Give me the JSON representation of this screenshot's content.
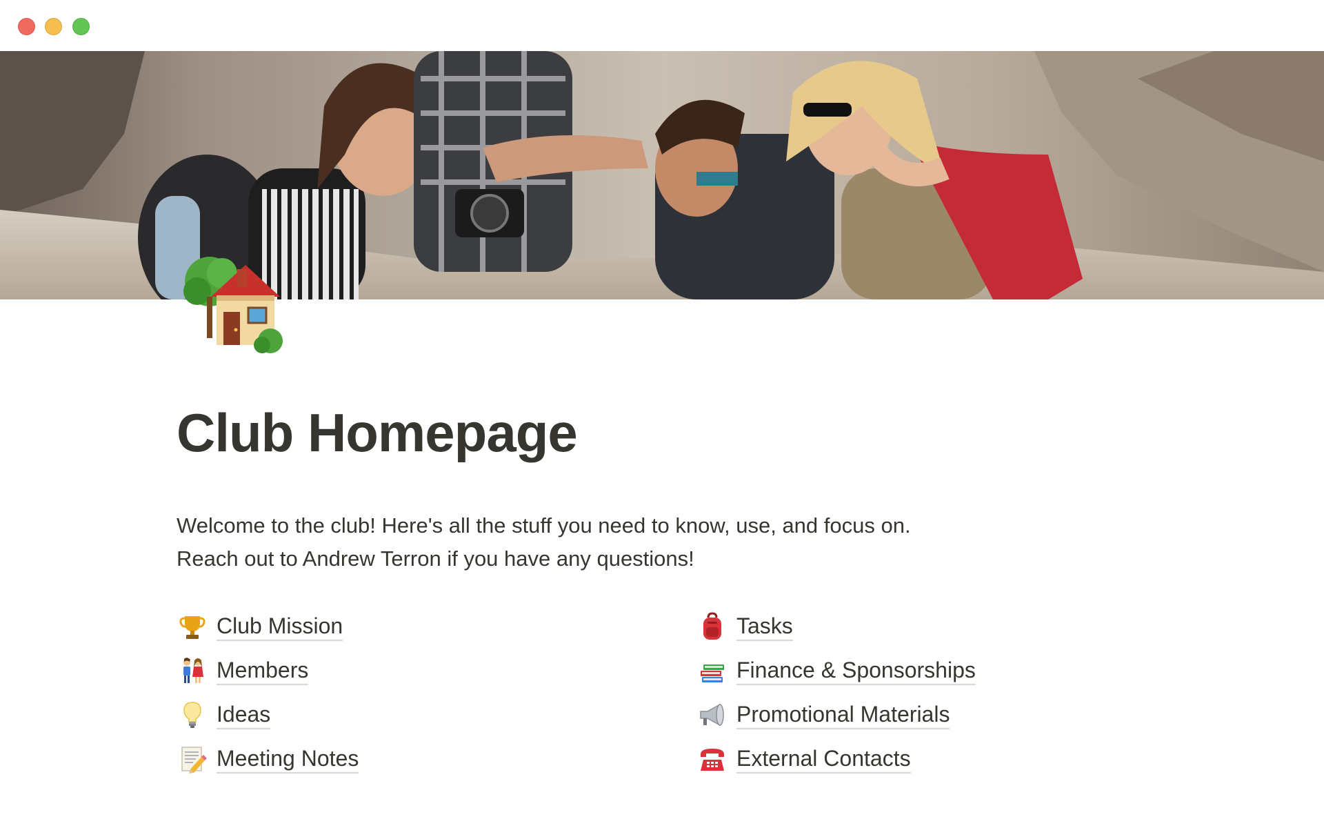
{
  "window": {
    "controls": [
      "close",
      "minimize",
      "maximize"
    ]
  },
  "cover": {
    "description_icon": "cover-photo"
  },
  "page": {
    "icon": "house-with-garden-icon",
    "title": "Club Homepage",
    "intro_lines": [
      "Welcome to the club! Here's all the stuff you need to know, use, and focus on.",
      "Reach out to Andrew Terron if you have any questions!"
    ]
  },
  "links_left": [
    {
      "icon": "trophy-icon",
      "label": "Club Mission"
    },
    {
      "icon": "people-icon",
      "label": "Members"
    },
    {
      "icon": "lightbulb-icon",
      "label": "Ideas"
    },
    {
      "icon": "memo-icon",
      "label": "Meeting Notes"
    }
  ],
  "links_right": [
    {
      "icon": "backpack-icon",
      "label": "Tasks"
    },
    {
      "icon": "books-icon",
      "label": "Finance & Sponsorships"
    },
    {
      "icon": "megaphone-icon",
      "label": "Promotional Materials"
    },
    {
      "icon": "telephone-icon",
      "label": "External Contacts"
    }
  ],
  "colors": {
    "text": "#37352f",
    "underline": "#d9d8d5",
    "close": "#ee6a5f",
    "minimize": "#f5be4f",
    "maximize": "#62c554"
  }
}
